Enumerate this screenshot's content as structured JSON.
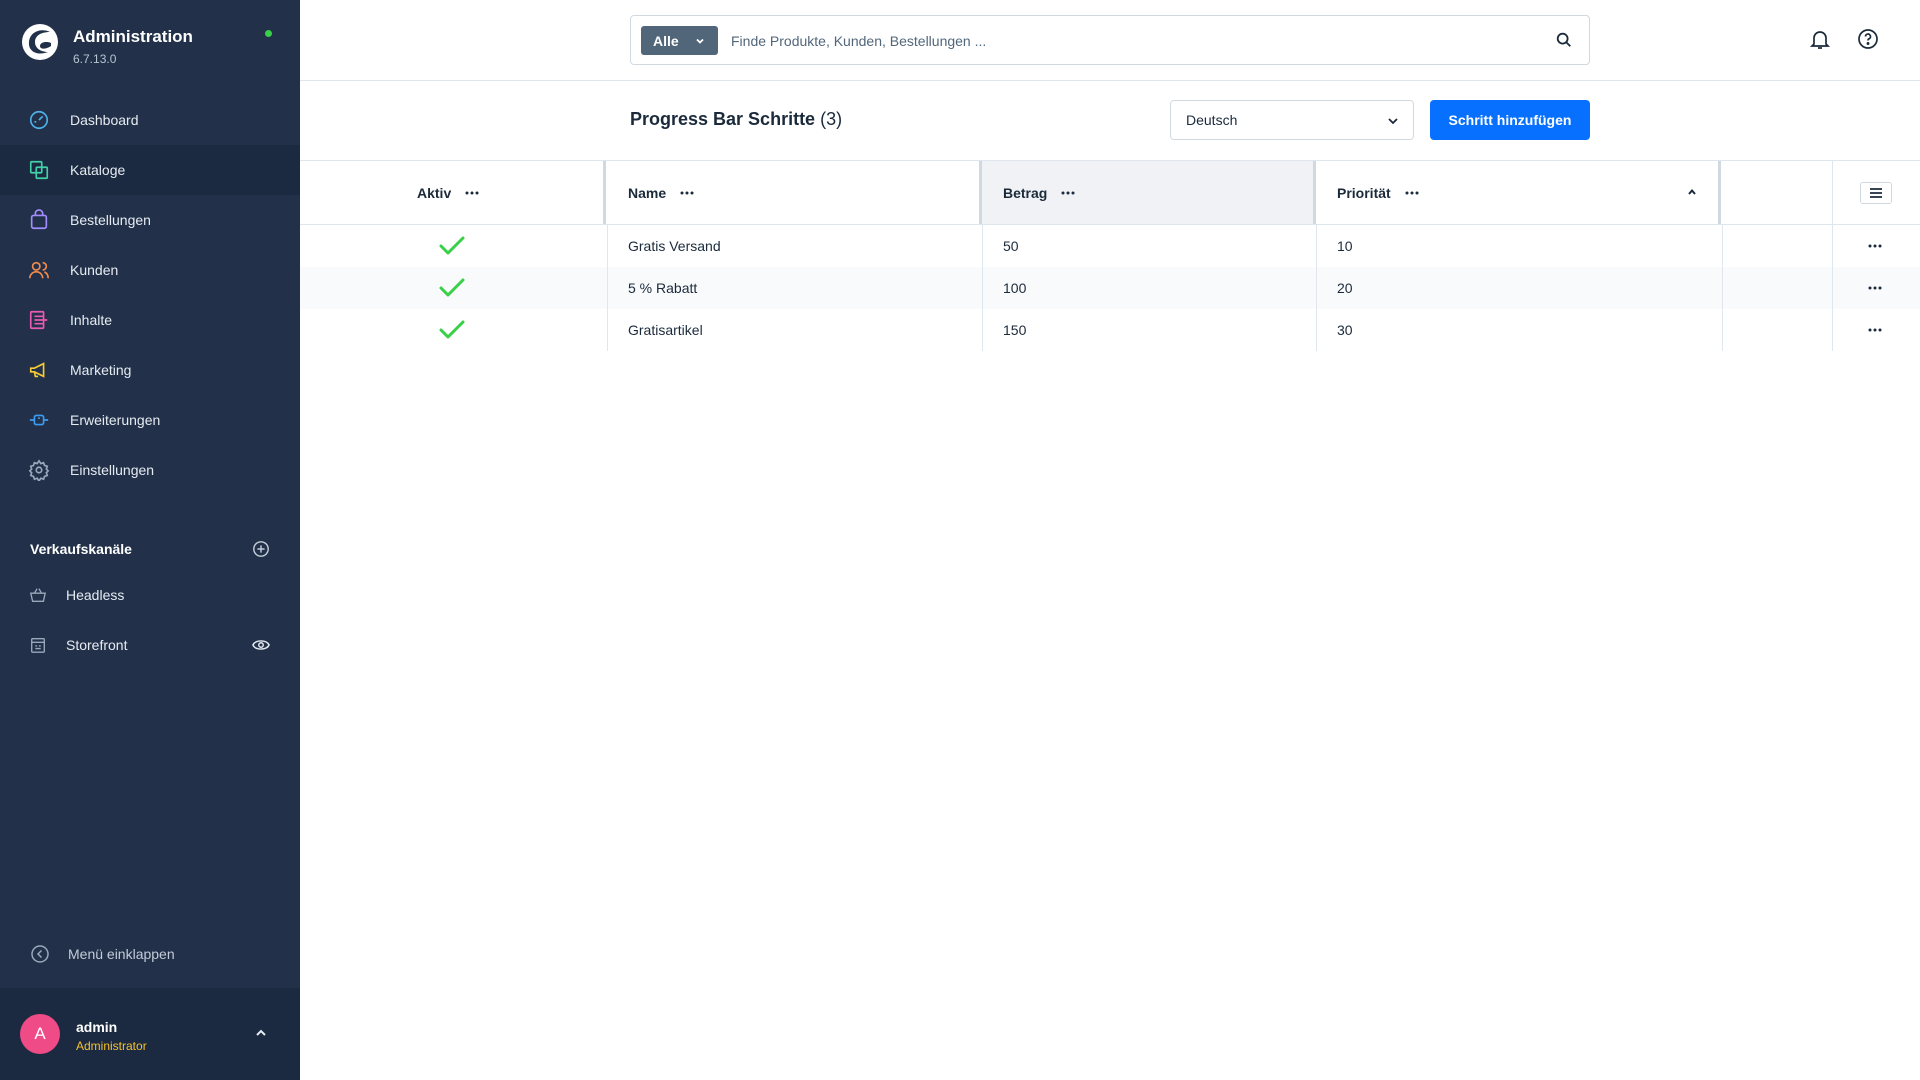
{
  "app": {
    "title": "Administration",
    "version": "6.7.13.0"
  },
  "nav": {
    "items": [
      {
        "label": "Dashboard",
        "icon": "dashboard-icon"
      },
      {
        "label": "Kataloge",
        "icon": "catalog-icon",
        "active": true
      },
      {
        "label": "Bestellungen",
        "icon": "shopping-bag-icon"
      },
      {
        "label": "Kunden",
        "icon": "users-icon"
      },
      {
        "label": "Inhalte",
        "icon": "content-icon"
      },
      {
        "label": "Marketing",
        "icon": "megaphone-icon"
      },
      {
        "label": "Erweiterungen",
        "icon": "plug-icon"
      },
      {
        "label": "Einstellungen",
        "icon": "gear-icon"
      }
    ]
  },
  "sales_channels": {
    "title": "Verkaufskanäle",
    "items": [
      {
        "label": "Headless",
        "icon": "basket-icon"
      },
      {
        "label": "Storefront",
        "icon": "storefront-icon"
      }
    ]
  },
  "sidebar_footer": {
    "collapse_label": "Menü einklappen"
  },
  "user": {
    "initial": "A",
    "name": "admin",
    "role": "Administrator"
  },
  "search": {
    "type_label": "Alle",
    "placeholder": "Finde Produkte, Kunden, Bestellungen ..."
  },
  "page": {
    "title": "Progress Bar Schritte",
    "count": "(3)",
    "language": "Deutsch",
    "add_button": "Schritt hinzufügen"
  },
  "grid": {
    "columns": [
      "Aktiv",
      "Name",
      "Betrag",
      "Priorität"
    ],
    "rows": [
      {
        "active": true,
        "name": "Gratis Versand",
        "amount": "50",
        "priority": "10"
      },
      {
        "active": true,
        "name": "5 % Rabatt",
        "amount": "100",
        "priority": "20"
      },
      {
        "active": true,
        "name": "Gratisartikel",
        "amount": "150",
        "priority": "30"
      }
    ],
    "sort_direction": "ascending"
  },
  "colors": {
    "sidebar_bg": "#223149",
    "primary": "#0870ff",
    "check": "#37d046",
    "status_dot": "#37d046",
    "avatar": "#ee4b87",
    "role": "#f6c12e"
  }
}
